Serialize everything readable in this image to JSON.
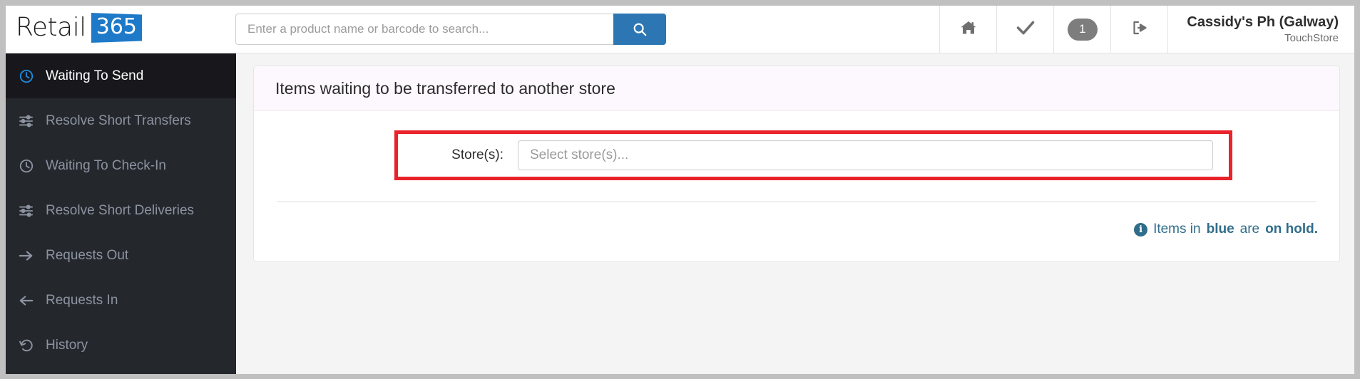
{
  "brand": {
    "word": "Retail",
    "badge": "365"
  },
  "search": {
    "placeholder": "Enter a product name or barcode to search...",
    "value": "",
    "button_icon": "search-icon"
  },
  "header_tools": [
    {
      "name": "home-button",
      "icon": "home-icon",
      "label": ""
    },
    {
      "name": "check-button",
      "icon": "check-icon",
      "label": ""
    },
    {
      "name": "notification-count-button",
      "icon": "badge",
      "label": "1"
    },
    {
      "name": "logout-button",
      "icon": "logout-icon",
      "label": ""
    }
  ],
  "store_account": {
    "name": "Cassidy's Ph (Galway)",
    "system": "TouchStore"
  },
  "sidebar": {
    "items": [
      {
        "label": "Waiting To Send",
        "icon": "clock-icon",
        "active": true
      },
      {
        "label": "Resolve Short Transfers",
        "icon": "sliders-icon",
        "active": false
      },
      {
        "label": "Waiting To Check-In",
        "icon": "clock-icon",
        "active": false
      },
      {
        "label": "Resolve Short Deliveries",
        "icon": "sliders-icon",
        "active": false
      },
      {
        "label": "Requests Out",
        "icon": "arrow-right-icon",
        "active": false
      },
      {
        "label": "Requests In",
        "icon": "arrow-left-icon",
        "active": false
      },
      {
        "label": "History",
        "icon": "history-icon",
        "active": false
      }
    ]
  },
  "panel": {
    "title": "Items waiting to be transferred to another store",
    "store_field": {
      "label": "Store(s):",
      "placeholder": "Select store(s)...",
      "value": ""
    },
    "info_note": {
      "prefix": "Items in ",
      "highlight": "blue",
      "middle": " are ",
      "suffix": "on hold."
    }
  },
  "colors": {
    "accent_blue": "#1e7ac8",
    "search_button": "#2c77b3",
    "sidebar_bg": "#24272c",
    "sidebar_active_bg": "#18181c",
    "annotation_red": "#e8232a",
    "info_teal": "#2f6d8a"
  }
}
